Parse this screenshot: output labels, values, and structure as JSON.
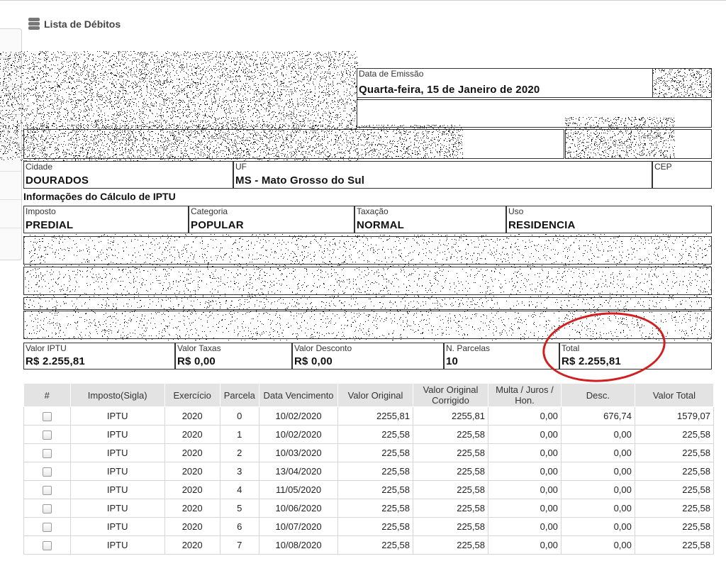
{
  "header": {
    "title": "Lista de Débitos",
    "icon": "database-icon"
  },
  "emission": {
    "label": "Data de Emissão",
    "value": "Quarta-feira, 15 de Janeiro de 2020"
  },
  "location": {
    "city_label": "Cidade",
    "city": "DOURADOS",
    "uf_label": "UF",
    "uf": "MS - Mato Grosso do Sul",
    "cep_label": "CEP",
    "cep": ""
  },
  "calc": {
    "title": "Informações do Cálculo de IPTU",
    "imposto_label": "Imposto",
    "imposto": "PREDIAL",
    "categoria_label": "Categoria",
    "categoria": "POPULAR",
    "taxacao_label": "Taxação",
    "taxacao": "NORMAL",
    "uso_label": "Uso",
    "uso": "RESIDENCIA"
  },
  "totals": {
    "valor_iptu_label": "Valor IPTU",
    "valor_iptu": "R$ 2.255,81",
    "valor_taxas_label": "Valor Taxas",
    "valor_taxas": "R$ 0,00",
    "valor_desconto_label": "Valor Desconto",
    "valor_desconto": "R$ 0,00",
    "parcelas_label": "N. Parcelas",
    "parcelas": "10",
    "total_label": "Total",
    "total": "R$ 2.255,81"
  },
  "highlight_color": "#d21e1e",
  "table": {
    "headers": [
      "#",
      "Imposto(Sigla)",
      "Exercício",
      "Parcela",
      "Data Vencimento",
      "Valor Original",
      "Valor Original Corrigido",
      "Multa / Juros / Hon.",
      "Desc.",
      "Valor Total"
    ],
    "rows": [
      [
        "IPTU",
        "2020",
        "0",
        "10/02/2020",
        "2255,81",
        "2255,81",
        "0,00",
        "676,74",
        "1579,07"
      ],
      [
        "IPTU",
        "2020",
        "1",
        "10/02/2020",
        "225,58",
        "225,58",
        "0,00",
        "0,00",
        "225,58"
      ],
      [
        "IPTU",
        "2020",
        "2",
        "10/03/2020",
        "225,58",
        "225,58",
        "0,00",
        "0,00",
        "225,58"
      ],
      [
        "IPTU",
        "2020",
        "3",
        "13/04/2020",
        "225,58",
        "225,58",
        "0,00",
        "0,00",
        "225,58"
      ],
      [
        "IPTU",
        "2020",
        "4",
        "11/05/2020",
        "225,58",
        "225,58",
        "0,00",
        "0,00",
        "225,58"
      ],
      [
        "IPTU",
        "2020",
        "5",
        "10/06/2020",
        "225,58",
        "225,58",
        "0,00",
        "0,00",
        "225,58"
      ],
      [
        "IPTU",
        "2020",
        "6",
        "10/07/2020",
        "225,58",
        "225,58",
        "0,00",
        "0,00",
        "225,58"
      ],
      [
        "IPTU",
        "2020",
        "7",
        "10/08/2020",
        "225,58",
        "225,58",
        "0,00",
        "0,00",
        "225,58"
      ]
    ]
  }
}
